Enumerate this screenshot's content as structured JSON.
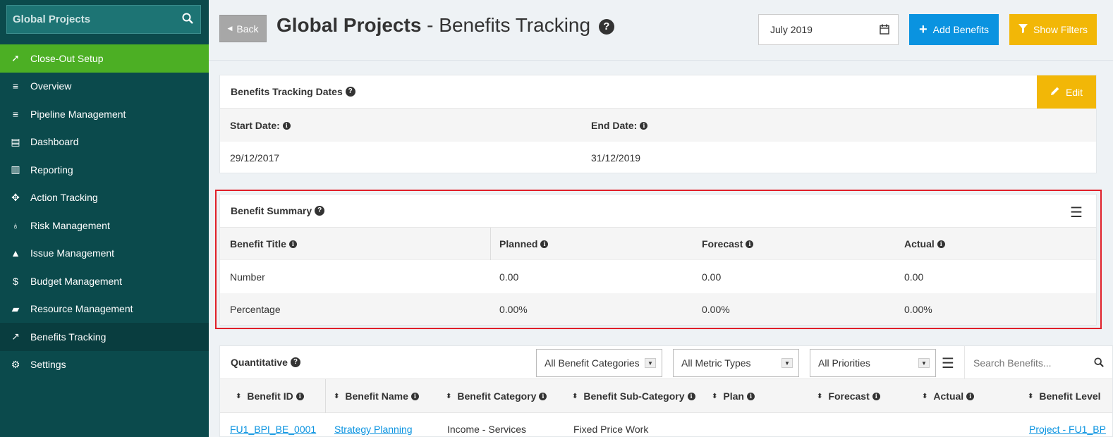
{
  "sidebar": {
    "search_label": "Global Projects",
    "items": [
      {
        "label": "Close-Out Setup",
        "icon": "rocket-icon",
        "glyph": "➚"
      },
      {
        "label": "Overview",
        "icon": "list-icon",
        "glyph": "≡"
      },
      {
        "label": "Pipeline Management",
        "icon": "list-icon",
        "glyph": "≡"
      },
      {
        "label": "Dashboard",
        "icon": "dashboard-icon",
        "glyph": "▤"
      },
      {
        "label": "Reporting",
        "icon": "bar-chart-icon",
        "glyph": "▥"
      },
      {
        "label": "Action Tracking",
        "icon": "crosshair-icon",
        "glyph": "✥"
      },
      {
        "label": "Risk Management",
        "icon": "lightbulb-icon",
        "glyph": "♁"
      },
      {
        "label": "Issue Management",
        "icon": "warning-icon",
        "glyph": "▲"
      },
      {
        "label": "Budget Management",
        "icon": "dollar-icon",
        "glyph": "$"
      },
      {
        "label": "Resource Management",
        "icon": "folder-icon",
        "glyph": "▰"
      },
      {
        "label": "Benefits Tracking",
        "icon": "line-chart-icon",
        "glyph": "↗"
      },
      {
        "label": "Settings",
        "icon": "gear-icon",
        "glyph": "⚙"
      }
    ]
  },
  "header": {
    "back_label": "Back",
    "title_bold": "Global Projects",
    "title_rest": " - Benefits Tracking",
    "date_value": "July 2019",
    "add_label": "Add Benefits",
    "filters_label": "Show Filters"
  },
  "dates_panel": {
    "title": "Benefits Tracking Dates",
    "edit_label": "Edit",
    "start_label": "Start Date:",
    "end_label": "End Date:",
    "start_value": "29/12/2017",
    "end_value": "31/12/2019"
  },
  "summary": {
    "title": "Benefit Summary",
    "columns": [
      "Benefit Title",
      "Planned",
      "Forecast",
      "Actual"
    ],
    "rows": [
      [
        "Number",
        "0.00",
        "0.00",
        "0.00"
      ],
      [
        "Percentage",
        "0.00%",
        "0.00%",
        "0.00%"
      ]
    ]
  },
  "quantitative": {
    "title": "Quantitative",
    "filters": [
      "All Benefit Categories",
      "All Metric Types",
      "All Priorities"
    ],
    "search_placeholder": "Search Benefits...",
    "columns": [
      "Benefit ID",
      "Benefit Name",
      "Benefit Category",
      "Benefit Sub-Category",
      "Plan",
      "Forecast",
      "Actual",
      "Benefit Level"
    ],
    "first_row": [
      "FU1_BPI_BE_0001",
      "Strategy Planning",
      "Income - Services",
      "Fixed Price Work",
      "Project - FU1_BP"
    ]
  },
  "colors": {
    "sidebar_bg": "#0b4a4c",
    "setup_green": "#4caf24",
    "primary_blue": "#0a93e0",
    "warning_yellow": "#f2b707",
    "highlight_red": "#e01f29"
  }
}
